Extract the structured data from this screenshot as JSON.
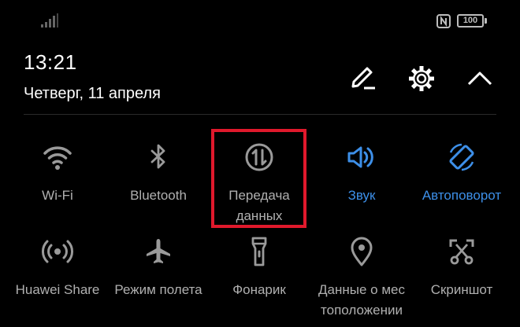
{
  "status_bar": {
    "battery_level": "100",
    "icons": [
      "signal-icon",
      "nfc-icon",
      "battery-icon"
    ]
  },
  "header": {
    "time": "13:21",
    "date": "Четверг, 11 апреля",
    "buttons": [
      "edit-icon",
      "settings-gear-icon",
      "collapse-chevron-icon"
    ]
  },
  "tiles": [
    {
      "label": "Wi-Fi",
      "icon": "wifi-icon",
      "active": false
    },
    {
      "label": "Bluetooth",
      "icon": "bluetooth-icon",
      "active": false
    },
    {
      "label": "Передача\nданных",
      "icon": "mobile-data-icon",
      "active": false,
      "highlighted": true
    },
    {
      "label": "Звук",
      "icon": "speaker-icon",
      "active": true
    },
    {
      "label": "Автоповорот",
      "icon": "auto-rotate-icon",
      "active": true
    },
    {
      "label": "Huawei Share",
      "icon": "huawei-share-icon",
      "active": false
    },
    {
      "label": "Режим полета",
      "icon": "airplane-icon",
      "active": false
    },
    {
      "label": "Фонарик",
      "icon": "flashlight-icon",
      "active": false
    },
    {
      "label": "Данные о мес\nтоположении",
      "icon": "location-pin-icon",
      "active": false
    },
    {
      "label": "Скриншот",
      "icon": "screenshot-icon",
      "active": false
    }
  ],
  "colors": {
    "background": "#000000",
    "inactive": "#b0b0b0",
    "active": "#3d8fe8",
    "highlight_border": "#e0192c"
  }
}
